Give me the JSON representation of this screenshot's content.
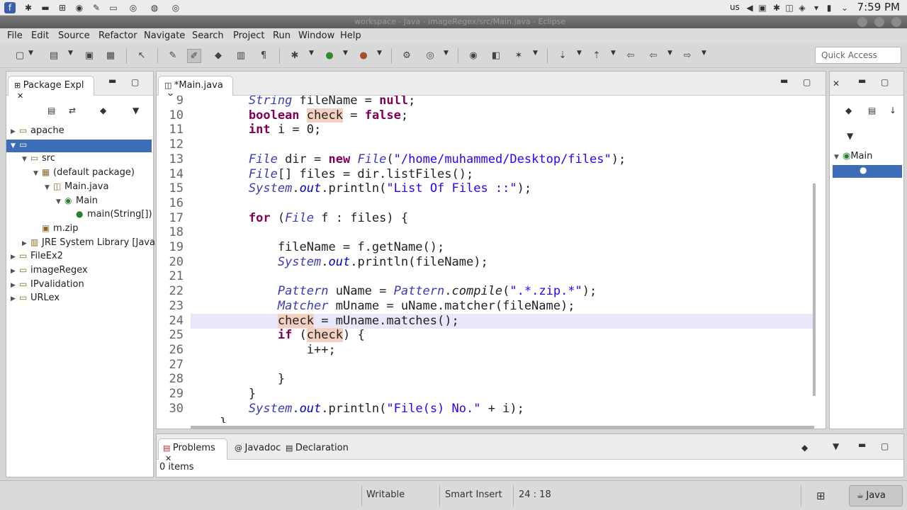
{
  "system_bar": {
    "keyboard": "us",
    "clock": "7:59 PM"
  },
  "window": {
    "title": "workspace - Java - imageRegex/src/Main.java - Eclipse"
  },
  "menu": [
    "File",
    "Edit",
    "Source",
    "Refactor",
    "Navigate",
    "Search",
    "Project",
    "Run",
    "Window",
    "Help"
  ],
  "toolbar": {
    "quick_access": "Quick Access"
  },
  "package_explorer": {
    "tab": "Package Expl",
    "tree": [
      {
        "label": "apache",
        "depth": 0,
        "expanded": false,
        "icon": "project-icon"
      },
      {
        "label": "",
        "depth": 0,
        "expanded": true,
        "icon": "project-icon",
        "selected": true
      },
      {
        "label": "src",
        "depth": 1,
        "expanded": true,
        "icon": "src-folder-icon"
      },
      {
        "label": "(default package)",
        "depth": 2,
        "expanded": true,
        "icon": "package-icon"
      },
      {
        "label": "Main.java",
        "depth": 3,
        "expanded": true,
        "icon": "java-file-icon"
      },
      {
        "label": "Main",
        "depth": 4,
        "expanded": true,
        "icon": "class-icon"
      },
      {
        "label": "main(String[])",
        "depth": 5,
        "expanded": false,
        "icon": "method-icon"
      },
      {
        "label": "m.zip",
        "depth": 2,
        "expanded": false,
        "icon": "zip-icon"
      },
      {
        "label": "JRE System Library [JavaS",
        "depth": 1,
        "expanded": false,
        "icon": "library-icon"
      },
      {
        "label": "FileEx2",
        "depth": 0,
        "expanded": false,
        "icon": "project-icon"
      },
      {
        "label": "imageRegex",
        "depth": 0,
        "expanded": false,
        "icon": "project-icon"
      },
      {
        "label": "IPvalidation",
        "depth": 0,
        "expanded": false,
        "icon": "project-icon"
      },
      {
        "label": "URLex",
        "depth": 0,
        "expanded": false,
        "icon": "project-icon"
      }
    ]
  },
  "editor": {
    "tab": "*Main.java",
    "lines": [
      {
        "n": "9",
        "code": "        String fileName = null;"
      },
      {
        "n": "10",
        "code": "        boolean check = false;"
      },
      {
        "n": "11",
        "code": "        int i = 0;"
      },
      {
        "n": "12",
        "code": ""
      },
      {
        "n": "13",
        "code": "        File dir = new File(\"/home/muhammed/Desktop/files\");"
      },
      {
        "n": "14",
        "code": "        File[] files = dir.listFiles();"
      },
      {
        "n": "15",
        "code": "        System.out.println(\"List Of Files ::\");"
      },
      {
        "n": "16",
        "code": ""
      },
      {
        "n": "17",
        "code": "        for (File f : files) {"
      },
      {
        "n": "18",
        "code": ""
      },
      {
        "n": "19",
        "code": "            fileName = f.getName();"
      },
      {
        "n": "20",
        "code": "            System.out.println(fileName);"
      },
      {
        "n": "21",
        "code": ""
      },
      {
        "n": "22",
        "code": "            Pattern uName = Pattern.compile(\".*.zip.*\");"
      },
      {
        "n": "23",
        "code": "            Matcher mUname = uName.matcher(fileName);"
      },
      {
        "n": "24",
        "code": "            check = mUname.matches();"
      },
      {
        "n": "25",
        "code": "            if (check) {"
      },
      {
        "n": "26",
        "code": "                i++;"
      },
      {
        "n": "27",
        "code": ""
      },
      {
        "n": "28",
        "code": "            }"
      },
      {
        "n": "29",
        "code": "        }"
      },
      {
        "n": "30",
        "code": "        System.out.println(\"File(s) No.\" + i);"
      },
      {
        "n": "",
        "code": "    }"
      }
    ],
    "current_line": "24"
  },
  "outline": {
    "items": [
      {
        "label": "Main",
        "icon": "class-icon"
      },
      {
        "label": "",
        "icon": "method-icon",
        "selected": true
      }
    ]
  },
  "bottom": {
    "tabs": [
      "Problems",
      "Javadoc",
      "Declaration"
    ],
    "summary": "0 items"
  },
  "status_bar": {
    "writable": "Writable",
    "insert_mode": "Smart Insert",
    "position": "24 : 18",
    "perspective": "Java"
  }
}
